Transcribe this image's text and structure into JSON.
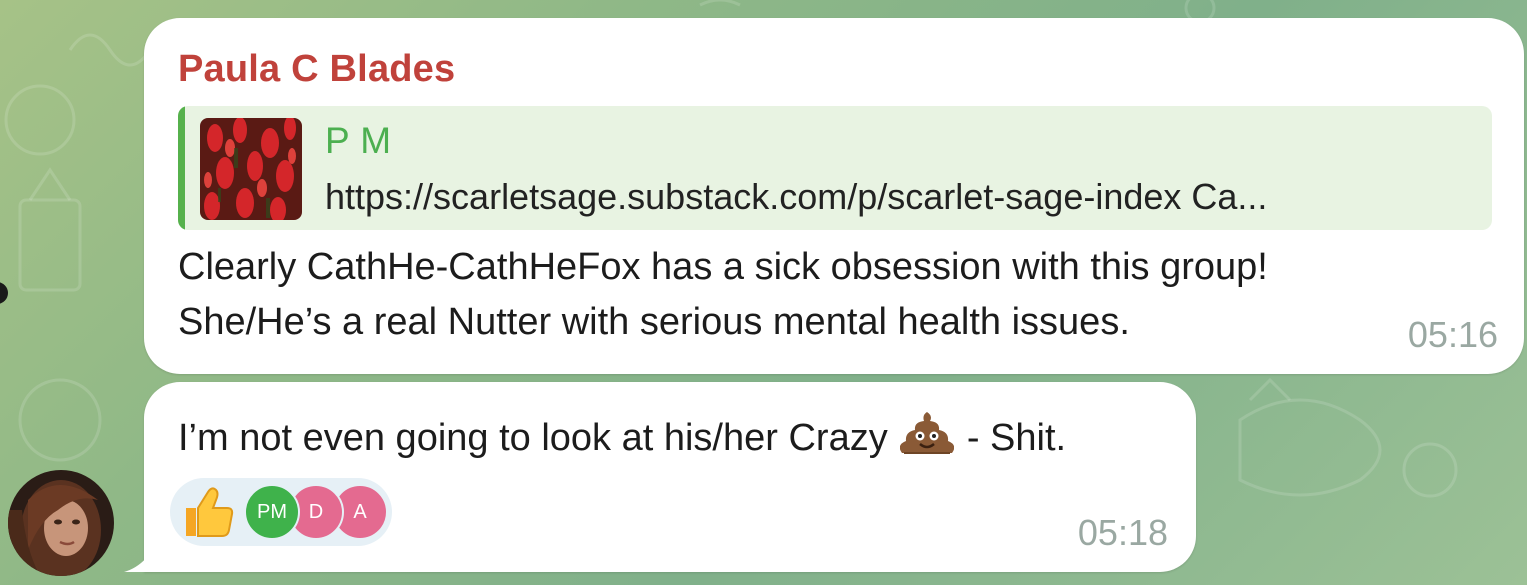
{
  "messages": [
    {
      "sender": "Paula C Blades",
      "reply": {
        "name": "P M",
        "text": "https://scarletsage.substack.com/p/scarlet-sage-index  Ca..."
      },
      "lines": [
        "Clearly CathHe-CathHeFox has a sick obsession with this group!",
        "She/He’s a real Nutter with serious mental health issues."
      ],
      "time": "05:16"
    },
    {
      "text_before_emoji": "I’m not even going to look at his/her Crazy",
      "text_after_emoji": "- Shit.",
      "inline_emoji": "pile-of-poo-emoji",
      "reactions": {
        "emoji": "thumbs-up-emoji",
        "users": [
          "PM",
          "D",
          "A"
        ]
      },
      "time": "05:18"
    }
  ],
  "colors": {
    "sender_name": "#c0423b",
    "reply_name": "#4caf50",
    "reply_bar": "#56b14c",
    "reply_bg": "#e8f3e2",
    "timestamp": "#9aa8a2",
    "reaction_pm": "#3fb24b",
    "reaction_d": "#e46a90",
    "reaction_a": "#e46a90"
  }
}
